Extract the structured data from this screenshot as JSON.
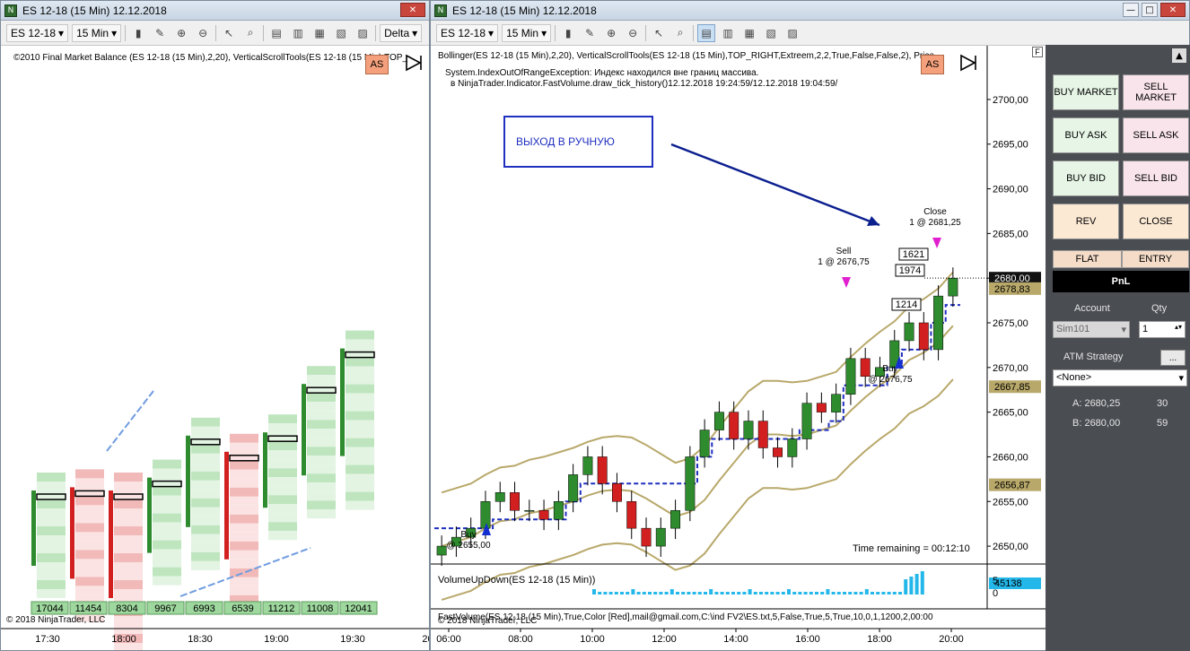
{
  "left_window": {
    "title": "ES 12-18 (15 Min)  12.12.2018",
    "toolbar": {
      "instrument": "ES 12-18",
      "interval": "15 Min",
      "delta_label": "Delta"
    },
    "indicator_label": "©2010 Final Market Balance  (ES 12-18 (15 Min),2,20), VerticalScrollTools(ES 12-18 (15 Min),TOP_",
    "as_label": "AS",
    "copyright": "© 2018 NinjaTrader, LLC",
    "volume_totals": [
      "17044",
      "11454",
      "8304",
      "9967",
      "6993",
      "6539",
      "11212",
      "11008",
      "12041"
    ],
    "time_labels": [
      "17:30",
      "18:00",
      "18:30",
      "19:00",
      "19:30",
      "20:"
    ]
  },
  "right_window": {
    "title": "ES 12-18 (15 Min)  12.12.2018",
    "toolbar": {
      "instrument": "ES 12-18",
      "interval": "15 Min"
    },
    "indicator_label": "Bollinger(ES 12-18 (15 Min),2,20), VerticalScrollTools(ES 12-18 (15 Min),TOP_RIGHT,Extreem,2,2,True,False,False,2), Price",
    "error_line1": "System.IndexOutOfRangeException: Индекс находился вне границ массива.",
    "error_line2": "в NinjaTrader.Indicator.FastVolume.draw_tick_history()12.12.2018 19:24:59/12.12.2018 19:04:59/",
    "annotation": "ВЫХОД В РУЧНУЮ",
    "as_label": "AS",
    "time_remaining": "Time remaining = 00:12:10",
    "volume_panel_label": "VolumeUpDown(ES 12-18 (15 Min))",
    "volume_value": "45138",
    "fastvolume_label": "FastVolume(ES 12-18 (15 Min),True,Color [Red],mail@gmail.com,C:\\ind FV2\\ES.txt,5,False,True,5,True,10,0,1,1200,2,00:00",
    "copyright": "© 2018 NinjaTrader, LLC",
    "orders": [
      {
        "label1": "Sell",
        "label2": "1 @ 2676,75"
      },
      {
        "label1": "Close",
        "label2": "1 @ 2681,25"
      },
      {
        "label1": "Buy",
        "label2": "@ 2655,00"
      },
      {
        "label1": "Buy",
        "label2": "@ 2676,75"
      }
    ],
    "counts": [
      "1621",
      "1974",
      "1214"
    ],
    "price_axis": [
      "2700,00",
      "2695,00",
      "2690,00",
      "2685,00",
      "2680,00",
      "2675,00",
      "2670,00",
      "2665,00",
      "2660,00",
      "2655,00",
      "2650,00"
    ],
    "price_badges": {
      "last": "2680,00",
      "upper": "2678,83",
      "mid": "2667,85",
      "lower": "2656,87"
    },
    "volume_axis": [
      "5",
      "0"
    ],
    "time_axis": [
      "06:00",
      "08:00",
      "10:00",
      "12:00",
      "14:00",
      "16:00",
      "18:00",
      "20:00"
    ]
  },
  "order_panel": {
    "buy_market": "BUY MARKET",
    "sell_market": "SELL MARKET",
    "buy_ask": "BUY ASK",
    "sell_ask": "SELL ASK",
    "buy_bid": "BUY BID",
    "sell_bid": "SELL BID",
    "rev": "REV",
    "close": "CLOSE",
    "flat": "FLAT",
    "entry": "ENTRY",
    "pnl": "PnL",
    "account_label": "Account",
    "qty_label": "Qty",
    "account_value": "Sim101",
    "qty_value": "1",
    "atm_label": "ATM Strategy",
    "atm_value": "<None>",
    "ask_label": "A: 2680,25",
    "ask_qty": "30",
    "bid_label": "B: 2680,00",
    "bid_qty": "59"
  },
  "colors": {
    "up": "#2e8b2e",
    "down": "#d22020",
    "bollinger": "#b8a86a",
    "stop": "#1f2fbf",
    "accent": "#1a1a1a"
  },
  "chart_data": {
    "type": "candlestick",
    "xlabel": "",
    "ylabel": "",
    "ylim": [
      2648,
      2702
    ],
    "x": [
      "06:00",
      "08:00",
      "10:00",
      "12:00",
      "14:00",
      "16:00",
      "18:00",
      "20:00"
    ],
    "series": [
      {
        "values": [
          2650,
          2651,
          2652,
          2655,
          2656,
          2654,
          2654,
          2653,
          2655,
          2658,
          2660,
          2657,
          2655,
          2652,
          2650,
          2652,
          2654,
          2660,
          2663,
          2665,
          2662,
          2664,
          2661,
          2660,
          2662,
          2666,
          2665,
          2667,
          2671,
          2669,
          2670,
          2673,
          2675,
          2672,
          2678,
          2680
        ]
      }
    ]
  }
}
